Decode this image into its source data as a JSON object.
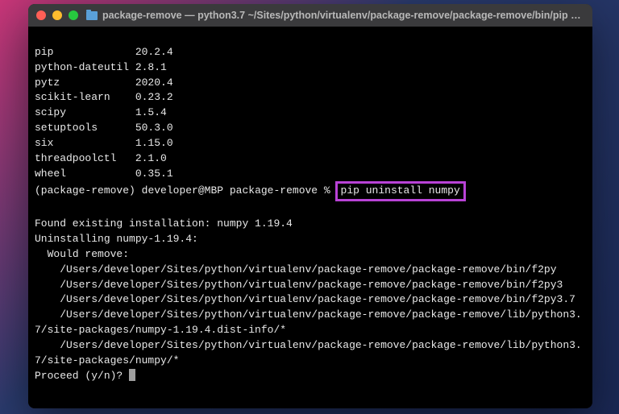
{
  "window": {
    "title": "package-remove — python3.7 ~/Sites/python/virtualenv/package-remove/package-remove/bin/pip u..."
  },
  "packages": [
    {
      "name": "pip",
      "version": "20.2.4"
    },
    {
      "name": "python-dateutil",
      "version": "2.8.1"
    },
    {
      "name": "pytz",
      "version": "2020.4"
    },
    {
      "name": "scikit-learn",
      "version": "0.23.2"
    },
    {
      "name": "scipy",
      "version": "1.5.4"
    },
    {
      "name": "setuptools",
      "version": "50.3.0"
    },
    {
      "name": "six",
      "version": "1.15.0"
    },
    {
      "name": "threadpoolctl",
      "version": "2.1.0"
    },
    {
      "name": "wheel",
      "version": "0.35.1"
    }
  ],
  "prompt": {
    "venv": "(package-remove)",
    "user_host": "developer@MBP",
    "cwd": "package-remove",
    "symbol": "%",
    "command": "pip uninstall numpy"
  },
  "output": {
    "found": "Found existing installation: numpy 1.19.4",
    "uninstalling": "Uninstalling numpy-1.19.4:",
    "would_remove": "  Would remove:",
    "paths": [
      "    /Users/developer/Sites/python/virtualenv/package-remove/package-remove/bin/f2py",
      "    /Users/developer/Sites/python/virtualenv/package-remove/package-remove/bin/f2py3",
      "    /Users/developer/Sites/python/virtualenv/package-remove/package-remove/bin/f2py3.7",
      "    /Users/developer/Sites/python/virtualenv/package-remove/package-remove/lib/python3.7/site-packages/numpy-1.19.4.dist-info/*",
      "    /Users/developer/Sites/python/virtualenv/package-remove/package-remove/lib/python3.7/site-packages/numpy/*"
    ],
    "proceed": "Proceed (y/n)? "
  }
}
